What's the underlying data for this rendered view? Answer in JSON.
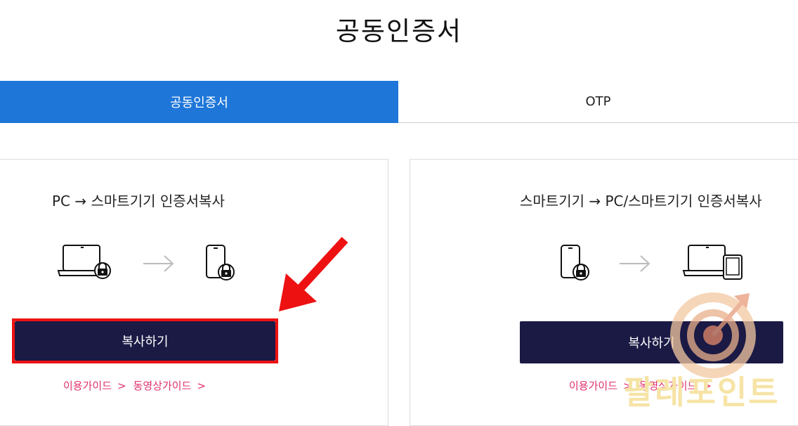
{
  "header": {
    "title": "공동인증서"
  },
  "tabs": [
    {
      "label": "공동인증서",
      "active": true
    },
    {
      "label": "OTP",
      "active": false
    }
  ],
  "cards": [
    {
      "title": "PC → 스마트기기 인증서복사",
      "button_label": "복사하기",
      "links": [
        "이용가이드",
        "동영상가이드"
      ],
      "link_arrow": ">"
    },
    {
      "title": "스마트기기 → PC/스마트기기 인증서복사",
      "button_label": "복사하기",
      "links": [
        "이용가이드",
        "동영상가이드"
      ],
      "link_arrow": ">"
    }
  ],
  "watermark": {
    "text": "팔레포인트"
  },
  "colors": {
    "active_tab": "#1e76d9",
    "button": "#1b1a45",
    "link": "#e0306f",
    "highlight": "#ee1111"
  }
}
